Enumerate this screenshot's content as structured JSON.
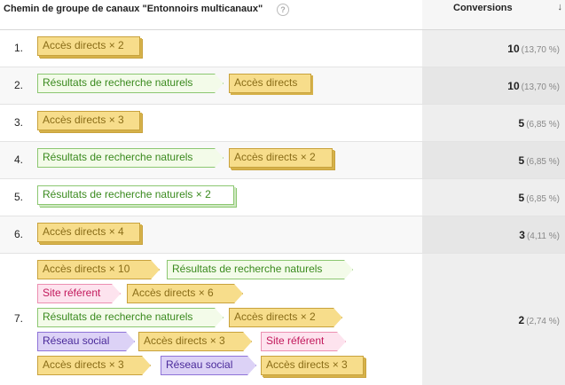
{
  "header": {
    "title": "Chemin de groupe de canaux \"Entonnoirs multicanaux\"",
    "help_icon": "?",
    "conversions_label": "Conversions",
    "sort_icon": "↓"
  },
  "rows": [
    {
      "num": "1.",
      "conv": "10",
      "pct": "(13,70 %)"
    },
    {
      "num": "2.",
      "conv": "10",
      "pct": "(13,70 %)"
    },
    {
      "num": "3.",
      "conv": "5",
      "pct": "(6,85 %)"
    },
    {
      "num": "4.",
      "conv": "5",
      "pct": "(6,85 %)"
    },
    {
      "num": "5.",
      "conv": "5",
      "pct": "(6,85 %)"
    },
    {
      "num": "6.",
      "conv": "3",
      "pct": "(4,11 %)"
    },
    {
      "num": "7.",
      "conv": "2",
      "pct": "(2,74 %)"
    }
  ],
  "chips": {
    "r1": [
      "Accès directs × 2"
    ],
    "r2": [
      "Résultats de recherche naturels",
      "Accès directs"
    ],
    "r3": [
      "Accès directs × 3"
    ],
    "r4": [
      "Résultats de recherche naturels",
      "Accès directs × 2"
    ],
    "r5": [
      "Résultats de recherche naturels × 2"
    ],
    "r6": [
      "Accès directs × 4"
    ],
    "r7": [
      [
        "Accès directs × 10",
        "Résultats de recherche naturels"
      ],
      [
        "Site référent",
        "Accès directs × 6"
      ],
      [
        "Résultats de recherche naturels",
        "Accès directs × 2"
      ],
      [
        "Réseau social",
        "Accès directs × 3",
        "Site référent"
      ],
      [
        "Accès directs × 3",
        "Réseau social",
        "Accès directs × 3"
      ]
    ]
  },
  "colors": {
    "direct": "#f7dd8b",
    "organic": "#8cc771",
    "referral": "#fde3ee",
    "social": "#dcd2f6"
  }
}
